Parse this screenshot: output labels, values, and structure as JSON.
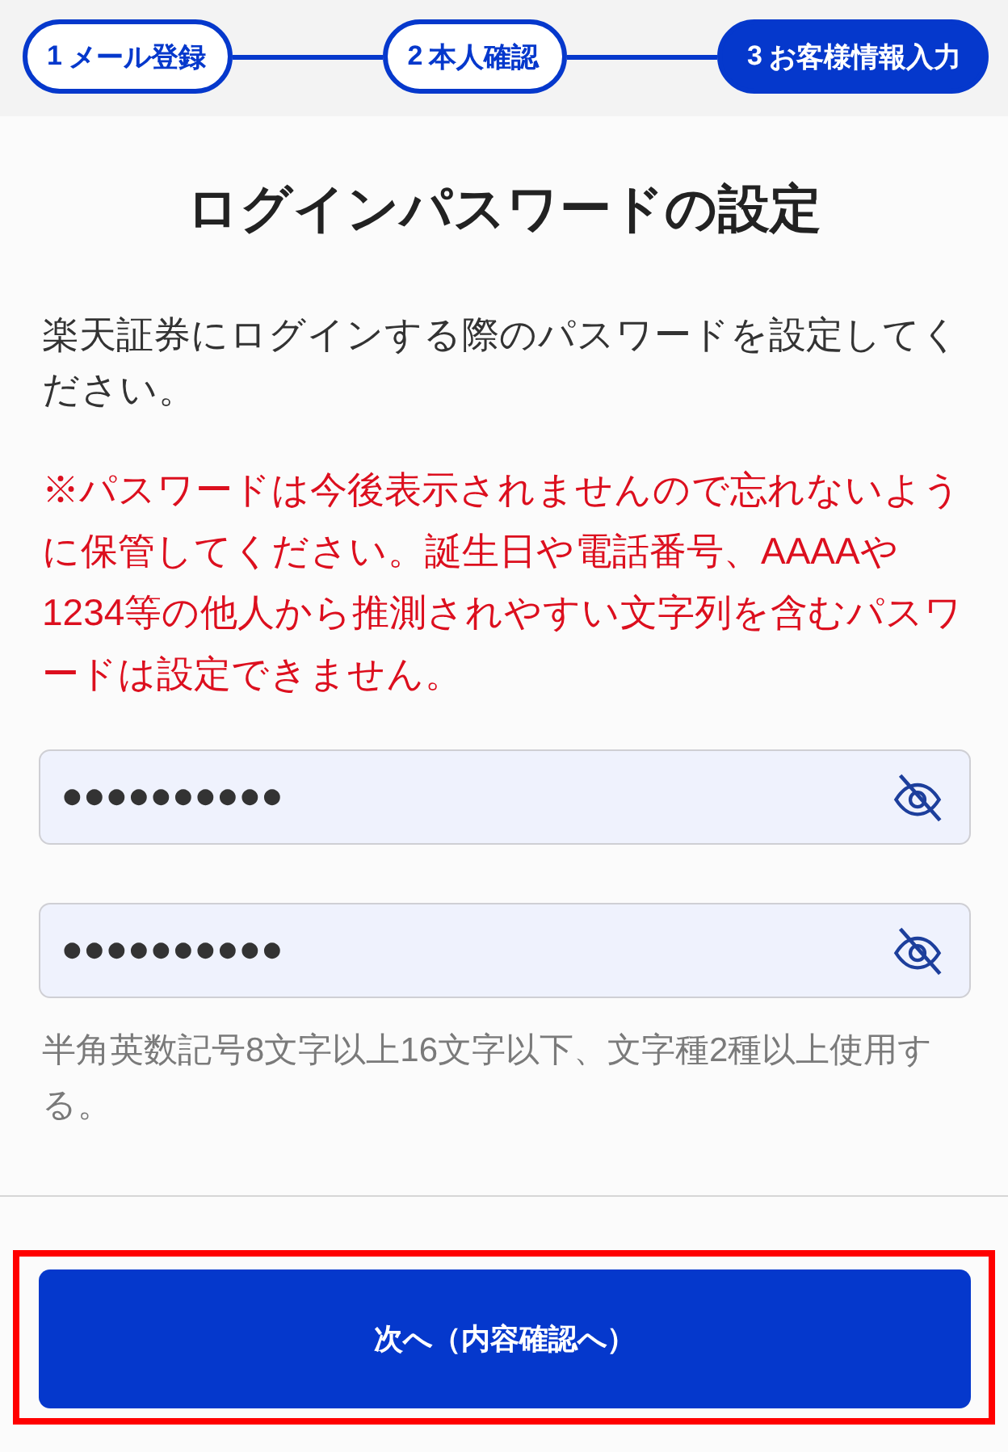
{
  "steps": [
    {
      "number": "1",
      "label": "メール登録",
      "selected": false
    },
    {
      "number": "2",
      "label": "本人確認",
      "selected": false
    },
    {
      "number": "3",
      "label": "お客様情報入力",
      "selected": true
    }
  ],
  "title": "ログインパスワードの設定",
  "intro": "楽天証券にログインする際のパスワードを設定してください。",
  "warning": "※パスワードは今後表示されませんので忘れないように保管してください。誕生日や電話番号、AAAAや1234等の他人から推測されやすい文字列を含むパスワードは設定できません。",
  "password_fields": [
    {
      "value": "●●●●●●●●●●",
      "masked": true
    },
    {
      "value": "●●●●●●●●●●",
      "masked": true
    }
  ],
  "hint": "半角英数記号8文字以上16文字以下、文字種2種以上使用する。",
  "next_button": {
    "label": "次へ（内容確認へ）",
    "highlighted": true
  }
}
